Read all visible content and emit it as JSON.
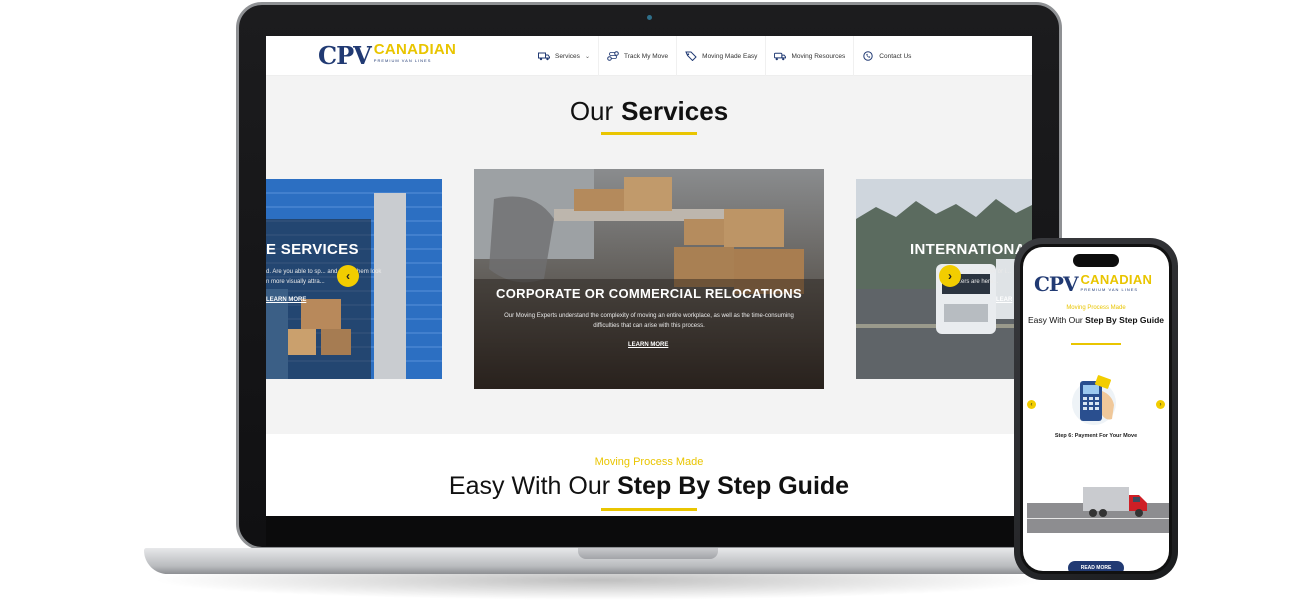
{
  "brand": {
    "mark": "CPV",
    "name": "CANADIAN",
    "tagline": "PREMIUM VAN LINES",
    "colors": {
      "navy": "#213a73",
      "yellow": "#e9c500"
    }
  },
  "nav": {
    "items": [
      {
        "label": "Services",
        "icon": "truck-icon",
        "has_dropdown": true
      },
      {
        "label": "Track My Move",
        "icon": "route-icon"
      },
      {
        "label": "Moving Made Easy",
        "icon": "tag-icon"
      },
      {
        "label": "Moving Resources",
        "icon": "truck-front-icon"
      },
      {
        "label": "Contact Us",
        "icon": "phone-icon"
      }
    ]
  },
  "services": {
    "title_regular": "Our",
    "title_bold": "Services",
    "cards": {
      "left": {
        "title": "E SERVICES",
        "line1": "d. Are you able to sp... and make them look",
        "line2": "n more visually attra...",
        "cta": "LEARN MORE"
      },
      "center": {
        "title": "CORPORATE OR COMMERCIAL RELOCATIONS",
        "text": "Our Moving Experts understand the complexity of moving an entire workplace, as well as the time-consuming difficulties that can arise with this process.",
        "cta": "LEARN MORE"
      },
      "right": {
        "title": "INTERNATIONA",
        "line1": "...ss the border or i...",
        "line2": "...ers are here...",
        "cta": "LEAR"
      }
    },
    "prev_icon": "chevron-left-icon",
    "next_icon": "chevron-right-icon"
  },
  "process": {
    "eyebrow": "Moving Process Made",
    "title_regular": "Easy With Our",
    "title_bold": "Step By Step Guide"
  },
  "phone": {
    "eyebrow": "Moving Process Made",
    "title_regular": "Easy With Our",
    "title_bold": "Step By Step Guide",
    "step_label": "Step 6: Payment For Your Move",
    "button": "READ MORE"
  }
}
